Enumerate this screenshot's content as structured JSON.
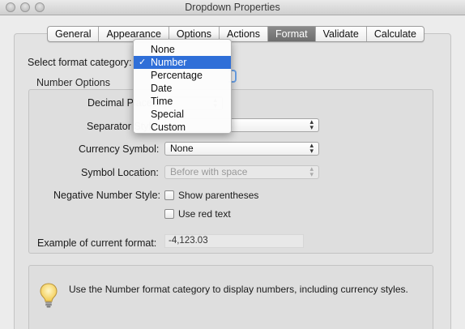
{
  "window": {
    "title": "Dropdown Properties"
  },
  "tabs": [
    {
      "label": "General",
      "active": false
    },
    {
      "label": "Appearance",
      "active": false
    },
    {
      "label": "Options",
      "active": false
    },
    {
      "label": "Actions",
      "active": false
    },
    {
      "label": "Format",
      "active": true
    },
    {
      "label": "Validate",
      "active": false
    },
    {
      "label": "Calculate",
      "active": false
    }
  ],
  "format": {
    "category_label": "Select format category:",
    "category_value": "Number"
  },
  "number_options": {
    "group_title": "Number Options",
    "decimal_label": "Decimal Places:",
    "separator_label": "Separator Style:",
    "currency_label": "Currency Symbol:",
    "currency_value": "None",
    "location_label": "Symbol Location:",
    "location_value": "Before with space",
    "negative_label": "Negative Number Style:",
    "show_parentheses_label": "Show parentheses",
    "use_red_text_label": "Use red text",
    "example_label": "Example of current format:",
    "example_value": "-4,123.03"
  },
  "tip": {
    "text": "Use the Number format category to display numbers, including currency styles."
  },
  "dropdown_menu": {
    "items": [
      "None",
      "Number",
      "Percentage",
      "Date",
      "Time",
      "Special",
      "Custom"
    ],
    "selected": "Number",
    "check_glyph": "✓"
  },
  "colors": {
    "selection": "#2f6fd8",
    "active_tab": "#7c7c7c"
  },
  "icons": {
    "tip": "lightbulb-icon"
  }
}
